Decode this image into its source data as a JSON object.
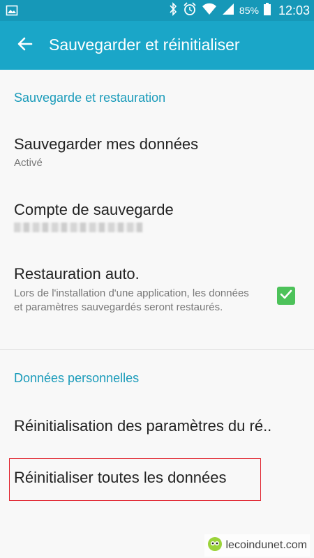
{
  "status_bar": {
    "battery_percent": "85%",
    "time": "12:03",
    "icons": [
      "image-icon",
      "bluetooth-icon",
      "alarm-icon",
      "wifi-icon",
      "signal-icon",
      "battery-icon"
    ]
  },
  "app_bar": {
    "title": "Sauvegarder et réinitialiser",
    "back_icon": "arrow-left-icon"
  },
  "sections": {
    "backup": {
      "header": "Sauvegarde et restauration",
      "backup_data": {
        "title": "Sauvegarder mes données",
        "status": "Activé"
      },
      "backup_account": {
        "title": "Compte de sauvegarde"
      },
      "auto_restore": {
        "title": "Restauration auto.",
        "description": "Lors de l'installation d'une application, les données et paramètres sauvegardés seront restaurés.",
        "checked": true
      }
    },
    "personal": {
      "header": "Données personnelles",
      "reset_settings": {
        "title": "Réinitialisation des paramètres du ré.."
      },
      "reset_all": {
        "title": "Réinitialiser toutes les données"
      }
    }
  },
  "watermark": {
    "text": "lecoindunet.com"
  },
  "colors": {
    "status_bar": "#1698b8",
    "app_bar": "#1aa6c8",
    "accent": "#1a9bba",
    "checkbox": "#4dc25a",
    "highlight": "#e0242e"
  }
}
